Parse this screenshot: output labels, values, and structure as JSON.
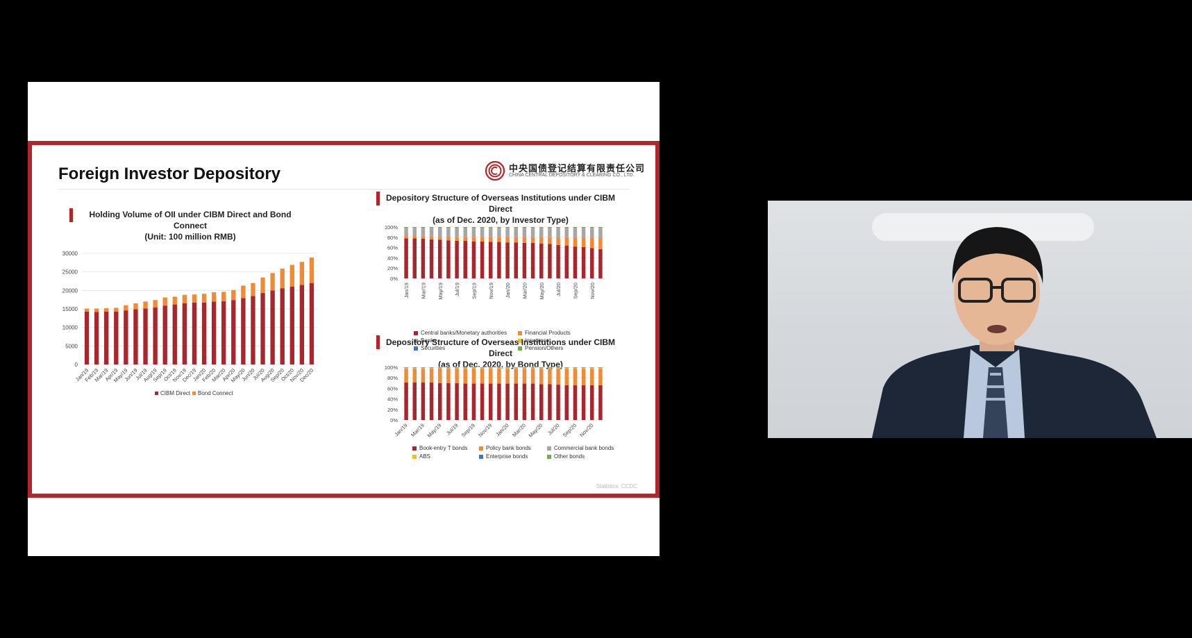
{
  "slide": {
    "title": "Foreign Investor Depository",
    "logo_cn": "中央国债登记结算有限责任公司",
    "logo_en": "CHINA CENTRAL DEPOSITORY & CLEARING CO., LTD.",
    "source": "Statistics: CCDC",
    "colors": {
      "brand": "#b0262b",
      "series_1": "#a8262c",
      "series_2": "#f08a35"
    }
  },
  "chart_data": [
    {
      "type": "bar",
      "title": "Holding Volume of OII under CIBM Direct and Bond Connect",
      "subtitle": "(Unit: 100 million RMB)",
      "stacked": true,
      "categories": [
        "Jan/19",
        "Feb/19",
        "Mar/19",
        "Apr/19",
        "May/19",
        "Jun/19",
        "Jul/19",
        "Aug/19",
        "Sep/19",
        "Oct/19",
        "Nov/19",
        "Dec/19",
        "Jan/20",
        "Feb/20",
        "Mar/20",
        "Apr/20",
        "May/20",
        "Jun/20",
        "Jul/20",
        "Aug/20",
        "Sep/20",
        "Oct/20",
        "Nov/20",
        "Dec/20"
      ],
      "series": [
        {
          "name": "CIBM Direct",
          "color": "#a8262c",
          "values": [
            14300,
            14200,
            14300,
            14300,
            14600,
            14900,
            15100,
            15400,
            15900,
            16200,
            16500,
            16700,
            16700,
            17000,
            17100,
            17400,
            17900,
            18500,
            19300,
            20000,
            20600,
            21000,
            21500,
            22000
          ]
        },
        {
          "name": "Bond Connect",
          "color": "#f08a35",
          "values": [
            800,
            900,
            900,
            1000,
            1400,
            1600,
            1900,
            2000,
            2200,
            2100,
            2300,
            2200,
            2400,
            2500,
            2500,
            2700,
            3400,
            3500,
            4200,
            4700,
            5300,
            5900,
            6200,
            6900
          ]
        }
      ],
      "yticks": [
        "30000",
        "25000",
        "20000",
        "15000",
        "10000",
        "5000",
        "0"
      ],
      "ylim": [
        0,
        30000
      ],
      "legend_position": "bottom"
    },
    {
      "type": "bar",
      "title": "Depository Structure of Overseas Institutions under CIBM Direct",
      "subtitle": "(as of Dec. 2020, by Investor Type)",
      "stacked": true,
      "percent": true,
      "categories": [
        "Jan/19",
        "Feb/19",
        "Mar/19",
        "Apr/19",
        "May/19",
        "Jun/19",
        "Jul/19",
        "Aug/19",
        "Sep/19",
        "Oct/19",
        "Nov/19",
        "Dec/19",
        "Jan/20",
        "Feb/20",
        "Mar/20",
        "Apr/20",
        "May/20",
        "Jun/20",
        "Jul/20",
        "Aug/20",
        "Sep/20",
        "Oct/20",
        "Nov/20",
        "Dec/20"
      ],
      "xtick_labels": [
        "Jan/19",
        "Mar/19",
        "May/19",
        "Jul/19",
        "Sep/19",
        "Nov/19",
        "Jan/20",
        "Mar/20",
        "May/20",
        "Jul/20",
        "Sep/20",
        "Nov/20"
      ],
      "series": [
        {
          "name": "Central banks/Monetary authorities",
          "color": "#a8262c",
          "values": [
            78,
            78,
            77,
            76,
            75,
            74,
            73,
            73,
            72,
            72,
            71,
            71,
            70,
            70,
            69,
            69,
            68,
            67,
            65,
            64,
            62,
            61,
            59,
            57
          ]
        },
        {
          "name": "Financial Products",
          "color": "#f08a35",
          "values": [
            5,
            5,
            5,
            6,
            6,
            7,
            7,
            7,
            8,
            8,
            9,
            9,
            10,
            10,
            11,
            11,
            12,
            13,
            14,
            16,
            17,
            18,
            20,
            22
          ]
        },
        {
          "name": "Banks",
          "color": "#a6a6a6",
          "values": [
            14,
            14,
            15,
            15,
            16,
            16,
            17,
            17,
            17,
            17,
            17,
            17,
            17,
            17,
            17,
            17,
            17,
            17,
            18,
            17,
            18,
            18,
            18,
            18
          ]
        },
        {
          "name": "Insurance",
          "color": "#f2c11c",
          "values": [
            1,
            1,
            1,
            1,
            1,
            1,
            1,
            1,
            1,
            1,
            1,
            1,
            1,
            1,
            1,
            1,
            1,
            1,
            1,
            1,
            1,
            1,
            1,
            1
          ]
        },
        {
          "name": "Securities",
          "color": "#4472c4",
          "values": [
            1,
            1,
            1,
            1,
            1,
            1,
            1,
            1,
            1,
            1,
            1,
            1,
            1,
            1,
            1,
            1,
            1,
            1,
            1,
            1,
            1,
            1,
            1,
            1
          ]
        },
        {
          "name": "Pension/Others",
          "color": "#70ad47",
          "values": [
            1,
            1,
            1,
            1,
            1,
            1,
            1,
            1,
            1,
            1,
            1,
            1,
            1,
            1,
            1,
            1,
            1,
            1,
            1,
            1,
            1,
            1,
            1,
            1
          ]
        }
      ],
      "yticks": [
        "100%",
        "80%",
        "60%",
        "40%",
        "20%",
        "0%"
      ],
      "ylim": [
        0,
        100
      ]
    },
    {
      "type": "bar",
      "title": "Depository Structure of Overseas Institutions under CIBM Direct",
      "subtitle": "(as of Dec. 2020, by Bond Type)",
      "stacked": true,
      "percent": true,
      "categories": [
        "Jan/19",
        "Feb/19",
        "Mar/19",
        "Apr/19",
        "May/19",
        "Jun/19",
        "Jul/19",
        "Aug/19",
        "Sep/19",
        "Oct/19",
        "Nov/19",
        "Dec/19",
        "Jan/20",
        "Feb/20",
        "Mar/20",
        "Apr/20",
        "May/20",
        "Jun/20",
        "Jul/20",
        "Aug/20",
        "Sep/20",
        "Oct/20",
        "Nov/20",
        "Dec/20"
      ],
      "xtick_labels": [
        "Jan/19",
        "Mar/19",
        "May/19",
        "Jul/19",
        "Sep/19",
        "Nov/19",
        "Jan/20",
        "Mar/20",
        "May/20",
        "Jul/20",
        "Sep/20",
        "Nov/20"
      ],
      "series": [
        {
          "name": "Book-entry T bonds",
          "color": "#a8262c",
          "values": [
            71,
            71,
            71,
            71,
            70,
            70,
            70,
            69,
            69,
            69,
            69,
            69,
            69,
            69,
            69,
            69,
            68,
            68,
            67,
            66,
            66,
            66,
            66,
            66
          ]
        },
        {
          "name": "Policy bank bonds",
          "color": "#f08a35",
          "values": [
            26,
            26,
            26,
            26,
            27,
            27,
            27,
            28,
            28,
            28,
            28,
            28,
            28,
            28,
            28,
            28,
            29,
            29,
            30,
            31,
            31,
            31,
            31,
            31
          ]
        },
        {
          "name": "Commercial bank bonds",
          "color": "#a6a6a6",
          "values": [
            1,
            1,
            1,
            1,
            1,
            1,
            1,
            1,
            1,
            1,
            1,
            1,
            1,
            1,
            1,
            1,
            1,
            1,
            1,
            1,
            1,
            1,
            1,
            1
          ]
        },
        {
          "name": "ABS",
          "color": "#f2c11c",
          "values": [
            1,
            1,
            1,
            1,
            1,
            1,
            1,
            1,
            1,
            1,
            1,
            1,
            1,
            1,
            1,
            1,
            1,
            1,
            1,
            1,
            1,
            1,
            1,
            1
          ]
        },
        {
          "name": "Enterprise bonds",
          "color": "#4472c4",
          "values": [
            0.5,
            0.5,
            0.5,
            0.5,
            0.5,
            0.5,
            0.5,
            0.5,
            0.5,
            0.5,
            0.5,
            0.5,
            0.5,
            0.5,
            0.5,
            0.5,
            0.5,
            0.5,
            0.5,
            0.5,
            0.5,
            0.5,
            0.5,
            0.5
          ]
        },
        {
          "name": "Other bonds",
          "color": "#70ad47",
          "values": [
            0.5,
            0.5,
            0.5,
            0.5,
            0.5,
            0.5,
            0.5,
            0.5,
            0.5,
            0.5,
            0.5,
            0.5,
            0.5,
            0.5,
            0.5,
            0.5,
            0.5,
            0.5,
            0.5,
            0.5,
            0.5,
            0.5,
            0.5,
            0.5
          ]
        }
      ],
      "yticks": [
        "100%",
        "80%",
        "60%",
        "40%",
        "20%",
        "0%"
      ],
      "ylim": [
        0,
        100
      ]
    }
  ]
}
